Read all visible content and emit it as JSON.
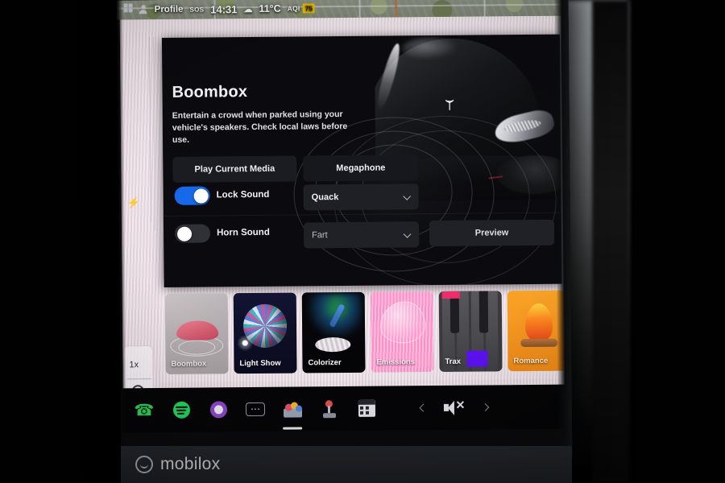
{
  "statusbar": {
    "profile_label": "Profile",
    "sos_label": "SOS",
    "time": "14:31",
    "temperature": "11°C",
    "aqi_label": "AQI",
    "aqi_value": "75",
    "aqi_color": "#f2c409",
    "weather_icon": "cloud-icon",
    "profile_icon": "person-icon",
    "grid_icon": "grid-icon"
  },
  "map_rail": {
    "charge_icon": "lightning-bolt-icon",
    "zoom_level": "1x",
    "search_icon": "search-icon"
  },
  "boombox": {
    "title": "Boombox",
    "description": "Entertain a crowd when parked using your vehicle's speakers. Check local laws before use.",
    "play_media_label": "Play Current Media",
    "megaphone_label": "Megaphone",
    "preview_label": "Preview",
    "lock_sound": {
      "label": "Lock Sound",
      "enabled": "true",
      "sound": "Quack",
      "chevron_icon": "chevron-down-icon"
    },
    "horn_sound": {
      "label": "Horn Sound",
      "enabled": "false",
      "sound": "Fart",
      "chevron_icon": "chevron-down-icon"
    },
    "toggle_on_color": "#1868ea",
    "toggle_off_color": "#303137",
    "car_icon": "tesla-car-photo",
    "wave_icon": "sound-wave-rings"
  },
  "cards": [
    {
      "label": "Boombox",
      "selected": "true",
      "art": "car-with-sound-rings-icon"
    },
    {
      "label": "Light Show",
      "selected": "false",
      "art": "disco-ball-icon"
    },
    {
      "label": "Colorizer",
      "selected": "false",
      "art": "eyedropper-icon"
    },
    {
      "label": "Emissions",
      "selected": "false",
      "art": "pink-bubble-icon"
    },
    {
      "label": "Trax",
      "selected": "false",
      "art": "piano-keys-icon"
    },
    {
      "label": "Romance",
      "selected": "false",
      "art": "campfire-icon"
    }
  ],
  "dock": {
    "items": [
      {
        "name": "phone-icon",
        "glyph": "✆",
        "color": "#2fd05a",
        "active": "false"
      },
      {
        "name": "spotify-icon",
        "glyph": "●",
        "color": "#1ed760",
        "active": "false"
      },
      {
        "name": "browser-icon",
        "glyph": "◉",
        "color": "#8b48c8",
        "active": "false"
      },
      {
        "name": "dashcam-icon",
        "glyph": "⋯",
        "color": "#d8d8de",
        "active": "false"
      },
      {
        "name": "toybox-icon",
        "glyph": "✿",
        "color": "#e2b44a",
        "active": "true"
      },
      {
        "name": "joystick-icon",
        "glyph": "⚈",
        "color": "#e06060",
        "active": "false"
      },
      {
        "name": "theater-icon",
        "glyph": "⚑",
        "color": "#e4e4ea",
        "active": "false"
      }
    ],
    "prev_icon": "chevron-left-icon",
    "next_icon": "chevron-right-icon",
    "mute_icon": "speaker-muted-icon"
  },
  "watermark": {
    "text": "mobilox",
    "logo_icon": "mobilox-logo-icon"
  }
}
